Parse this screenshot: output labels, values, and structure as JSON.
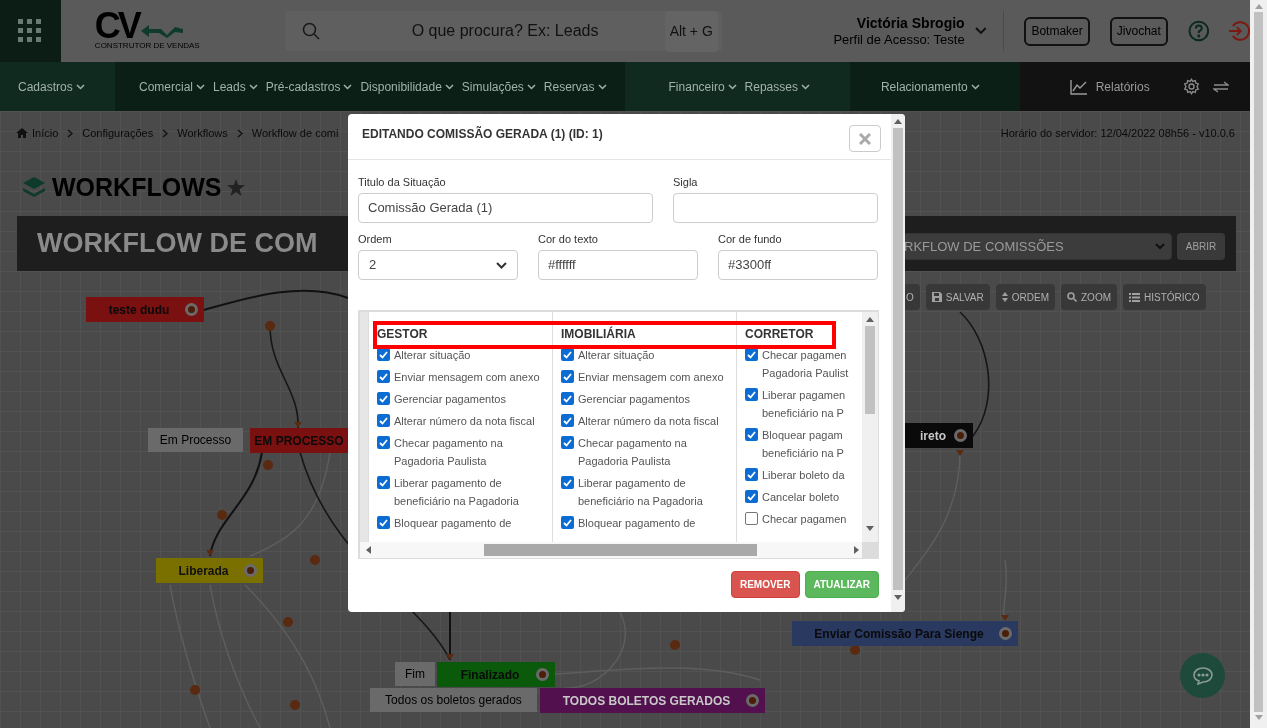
{
  "header": {
    "logo_text": "CV",
    "logo_tagline": "CONSTRUTOR DE VENDAS",
    "search": {
      "placeholder": "O que procura? Ex: Leads",
      "shortcut": "Alt + G"
    },
    "user": {
      "name": "Victória Sbrogio",
      "profile": "Perfil de Acesso: Teste"
    },
    "buttons": [
      "Botmaker",
      "Jivochat"
    ]
  },
  "nav": {
    "groups": [
      {
        "items": [
          "Cadastros"
        ]
      },
      {
        "items": [
          "Comercial",
          "Leads",
          "Pré-cadastros",
          "Disponibilidade",
          "Simulações",
          "Reservas"
        ]
      },
      {
        "items": [
          "Financeiro",
          "Repasses"
        ]
      },
      {
        "items": [
          "Relacionamento"
        ]
      }
    ],
    "reports": "Relatórios"
  },
  "breadcrumb": [
    "Início",
    "Configurações",
    "Workflows",
    "Workflow de comi"
  ],
  "server_time": "Horário do servidor: 12/04/2022 08h56 - v10.0.6",
  "page_title": "WORKFLOWS",
  "workflow_bar": {
    "title": "WORKFLOW DE COM",
    "select_value": "RKFLOW DE COMISSÕES",
    "open_button": "ABRIR"
  },
  "toolbar": [
    {
      "kind": "plain",
      "label": "O"
    },
    {
      "kind": "save",
      "label": "SALVAR"
    },
    {
      "kind": "order",
      "label": "ORDEM"
    },
    {
      "kind": "zoom",
      "label": "ZOOM"
    },
    {
      "kind": "history",
      "label": "HISTÓRICO"
    }
  ],
  "canvas": {
    "nodes": [
      {
        "label": "teste dudu",
        "color": "#7a1010"
      },
      {
        "label": "EM PROCESSO",
        "color": "#7a1010",
        "tag": "Em Processo"
      },
      {
        "label": "ireto",
        "color": "#0a0a0a"
      },
      {
        "label": "Liberada",
        "color": "#7a7000"
      },
      {
        "label": "Enviar Comissão Para Sienge",
        "color": "#2a3960"
      },
      {
        "label": "Finalizado",
        "color": "#0b5a0b",
        "tag": "Fim"
      },
      {
        "label": "TODOS BOLETOS GERADOS",
        "color": "#52104f",
        "tag": "Todos os boletos gerados"
      }
    ]
  },
  "modal": {
    "title": "EDITANDO COMISSÃO GERADA (1) (ID: 1)",
    "field_rows": [
      [
        {
          "kind": "text",
          "label": "Titulo da Situação",
          "value": "Comissão Gerada (1)"
        },
        {
          "kind": "text",
          "label": "Sigla"
        }
      ],
      [
        {
          "kind": "select",
          "label": "Ordem",
          "value": "2"
        },
        {
          "kind": "text",
          "label": "Cor do texto",
          "value": "#ffffff"
        },
        {
          "kind": "text",
          "label": "Cor de fundo",
          "value": "#3300ff"
        }
      ]
    ],
    "permissions": [
      {
        "role": "GESTOR",
        "items": [
          {
            "lines": [
              "Alterar situação"
            ],
            "checked": true
          },
          {
            "lines": [
              "Enviar mensagem com anexo"
            ],
            "checked": true
          },
          {
            "lines": [
              "Gerenciar pagamentos"
            ],
            "checked": true
          },
          {
            "lines": [
              "Alterar número da nota fiscal"
            ],
            "checked": true
          },
          {
            "lines": [
              "Checar pagamento na",
              "Pagadoria Paulista"
            ],
            "checked": true
          },
          {
            "lines": [
              "Liberar pagamento de",
              "beneficiário na Pagadoria"
            ],
            "checked": true
          },
          {
            "lines": [
              "Bloquear pagamento de"
            ],
            "checked": true
          }
        ]
      },
      {
        "role": "IMOBILIÁRIA",
        "items": [
          {
            "lines": [
              "Alterar situação"
            ],
            "checked": true
          },
          {
            "lines": [
              "Enviar mensagem com anexo"
            ],
            "checked": true
          },
          {
            "lines": [
              "Gerenciar pagamentos"
            ],
            "checked": true
          },
          {
            "lines": [
              "Alterar número da nota fiscal"
            ],
            "checked": true
          },
          {
            "lines": [
              "Checar pagamento na",
              "Pagadoria Paulista"
            ],
            "checked": true
          },
          {
            "lines": [
              "Liberar pagamento de",
              "beneficiário na Pagadoria"
            ],
            "checked": true
          },
          {
            "lines": [
              "Bloquear pagamento de"
            ],
            "checked": true
          }
        ]
      },
      {
        "role": "CORRETOR",
        "items": [
          {
            "lines": [
              "Checar pagamen",
              "Pagadoria Paulist"
            ],
            "checked": true
          },
          {
            "lines": [
              "Liberar pagamen",
              "beneficiário na P"
            ],
            "checked": true
          },
          {
            "lines": [
              "Bloquear pagam",
              "beneficiário na P"
            ],
            "checked": true
          },
          {
            "lines": [
              "Liberar boleto da"
            ],
            "checked": true
          },
          {
            "lines": [
              "Cancelar boleto"
            ],
            "checked": true
          },
          {
            "lines": [
              "Checar pagamen"
            ],
            "checked": false
          }
        ]
      }
    ],
    "buttons": [
      {
        "kind": "danger",
        "label": "REMOVER"
      },
      {
        "kind": "success",
        "label": "ATUALIZAR"
      }
    ]
  }
}
